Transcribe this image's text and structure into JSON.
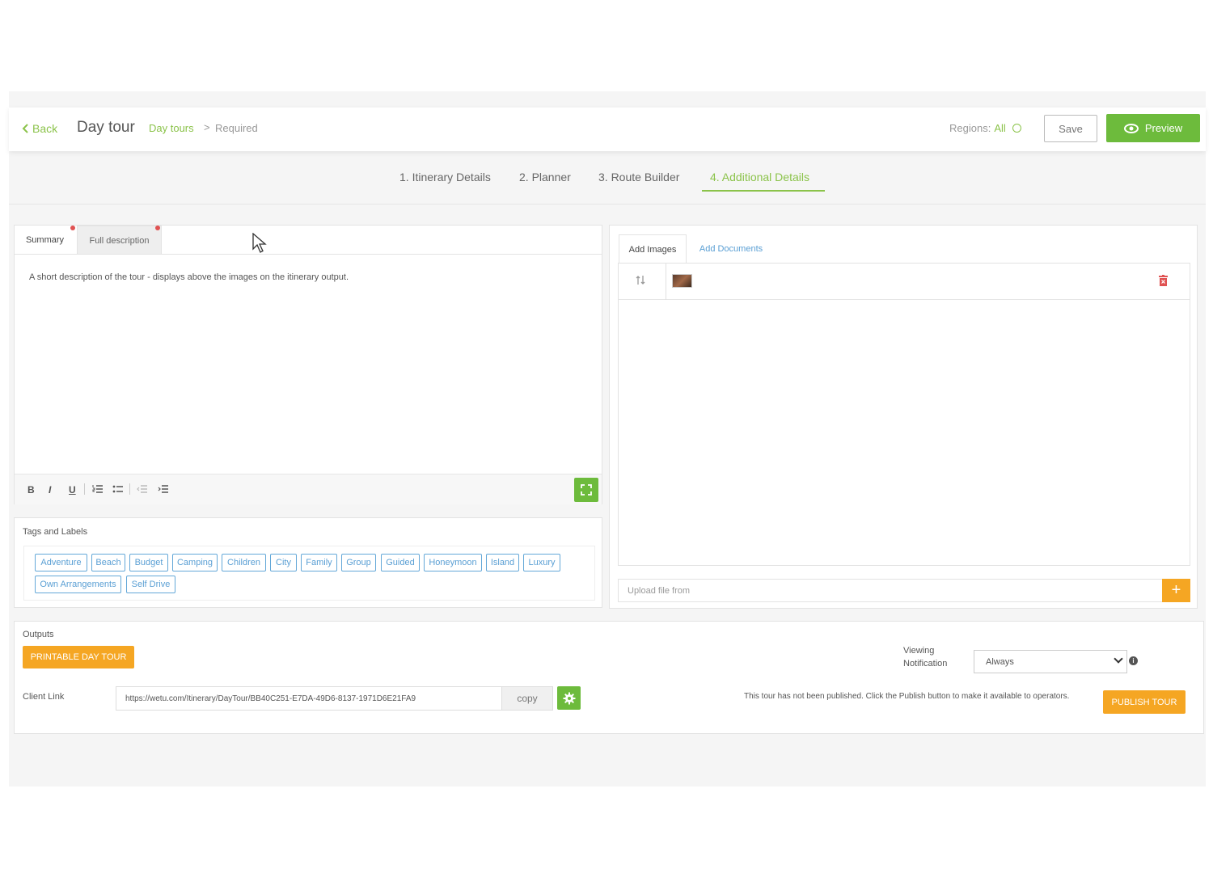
{
  "header": {
    "back_label": "Back",
    "title": "Day tour",
    "breadcrumb": [
      "Day tours",
      "Required"
    ],
    "breadcrumb_separator": ">",
    "regions_label": "Regions:",
    "regions_value": "All",
    "save_label": "Save",
    "preview_label": "Preview"
  },
  "steps": [
    {
      "label": "1. Itinerary Details",
      "active": false
    },
    {
      "label": "2. Planner",
      "active": false
    },
    {
      "label": "3. Route Builder",
      "active": false
    },
    {
      "label": "4. Additional Details",
      "active": true
    }
  ],
  "editor": {
    "tabs": [
      "Summary",
      "Full description"
    ],
    "active_tab": "Summary",
    "content": "A short description of the tour - displays above the images on the itinerary output.",
    "toolbar": [
      "bold",
      "italic",
      "underline",
      "ordered-list",
      "unordered-list",
      "outdent",
      "indent"
    ]
  },
  "tags": {
    "title": "Tags and Labels",
    "items": [
      "Adventure",
      "Beach",
      "Budget",
      "Camping",
      "Children",
      "City",
      "Family",
      "Group",
      "Guided",
      "Honeymoon",
      "Island",
      "Luxury",
      "Own Arrangements",
      "Self Drive"
    ]
  },
  "media": {
    "tabs": [
      "Add Images",
      "Add Documents"
    ],
    "active_tab": "Add Images",
    "upload_placeholder": "Upload file from",
    "upload_add": "+"
  },
  "outputs": {
    "title": "Outputs",
    "printable_label": "PRINTABLE DAY TOUR",
    "client_link_label": "Client Link",
    "client_link_value": "https://wetu.com/Itinerary/DayTour/BB40C251-E7DA-49D6-8137-1971D6E21FA9",
    "copy_label": "copy",
    "viewing_label_line1": "Viewing",
    "viewing_label_line2": "Notification",
    "viewing_value": "Always",
    "info_glyph": "i",
    "publish_note": "This tour has not been published. Click the Publish button to make it available to operators.",
    "publish_label": "PUBLISH TOUR"
  },
  "colors": {
    "accent_green": "#8bc34a",
    "button_green": "#6dbb3c",
    "orange": "#f5a623",
    "tag_blue": "#5a9fd4",
    "delete_red": "#e05252"
  }
}
